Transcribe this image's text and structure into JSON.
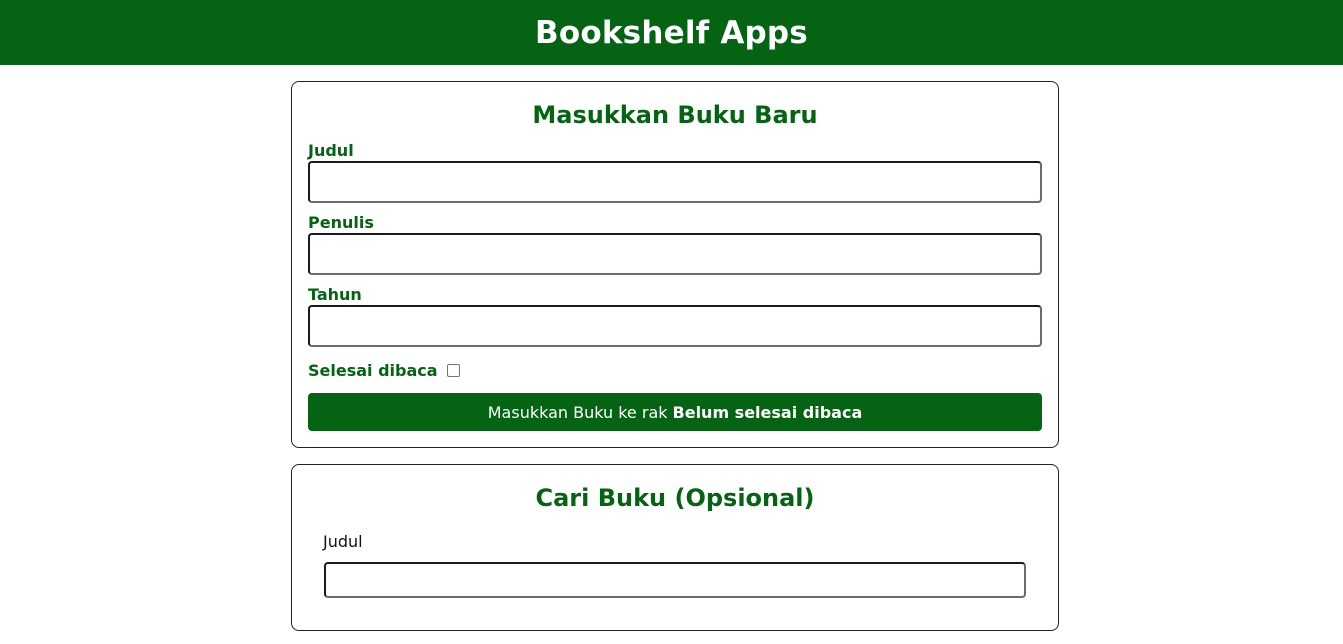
{
  "header": {
    "title": "Bookshelf Apps"
  },
  "input_section": {
    "title": "Masukkan Buku Baru",
    "fields": {
      "judul": {
        "label": "Judul",
        "value": ""
      },
      "penulis": {
        "label": "Penulis",
        "value": ""
      },
      "tahun": {
        "label": "Tahun",
        "value": ""
      }
    },
    "complete_checkbox": {
      "label": "Selesai dibaca",
      "checked": false
    },
    "submit_button": {
      "label_prefix": "Masukkan Buku ke rak",
      "label_strong": "Belum selesai dibaca"
    }
  },
  "search_section": {
    "title": "Cari Buku (Opsional)",
    "judul_label": "Judul",
    "judul_value": ""
  },
  "colors": {
    "brand_green": "#056314",
    "background": "#ffffff"
  }
}
